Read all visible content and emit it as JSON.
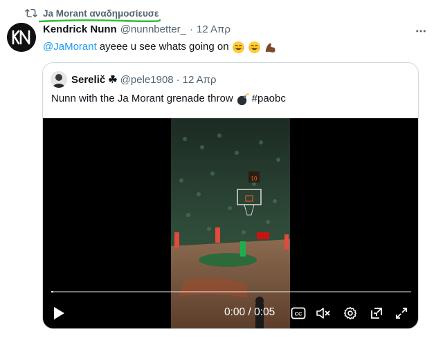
{
  "retweet": {
    "label": "Ja Morant αναδημοσίευσε"
  },
  "tweet": {
    "display_name": "Kendrick Nunn",
    "handle": "@nunnbetter_",
    "separator": "·",
    "date": "12 Απρ",
    "mention": "@JaMorant",
    "text": "ayeee u see whats going on",
    "emojis": [
      "face-with-tears-of-joy-emoji",
      "face-with-tears-of-joy-emoji",
      "flexed-biceps-emoji"
    ]
  },
  "quote": {
    "display_name": "Serelič",
    "name_symbol": "☘",
    "handle": "@pele1908",
    "separator": "·",
    "date": "12 Απρ",
    "text": "Nunn with the Ja Morant grenade throw",
    "emoji": "bomb-emoji",
    "hashtag": "#paobc"
  },
  "video": {
    "time": "0:00 / 0:05",
    "progress": 0.0,
    "scoreboard": "10",
    "controls": [
      "play-icon",
      "captions-icon",
      "mute-icon",
      "settings-icon",
      "popout-icon",
      "fullscreen-icon"
    ]
  },
  "colors": {
    "accent": "#1d9bf0",
    "secondary_text": "#536471",
    "highlight_underline": "#2fbf2f",
    "court_green": "#1f6b3a"
  }
}
